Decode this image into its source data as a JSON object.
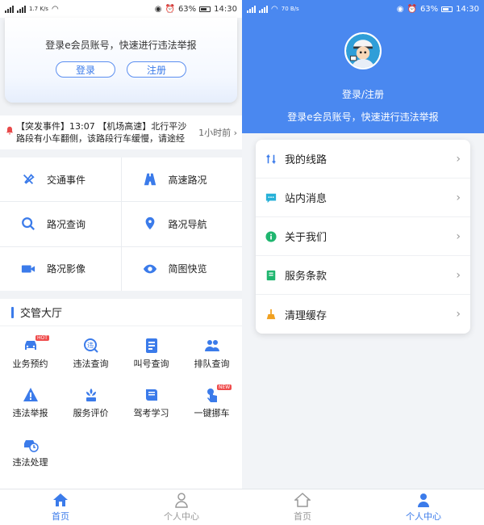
{
  "status_left": {
    "carrier": "⁴⁶ .ıll ⁴⁶ .ıll",
    "speed_left": "1.7 K/s",
    "speed_right": "70 B/s"
  },
  "status_right": {
    "battery": "63%",
    "time": "14:30"
  },
  "home": {
    "login_prompt": "登录e会员账号，快速进行违法举报",
    "login_button": "登录",
    "register_button": "注册",
    "news_text": "【突发事件】13:07 【机场高速】北行平沙路段有小车翻侧，该路段行车缓慢，请途经",
    "news_time": "1小时前",
    "services": [
      {
        "label": "交通事件",
        "icon": "alert-icon"
      },
      {
        "label": "高速路况",
        "icon": "road-icon"
      },
      {
        "label": "路况查询",
        "icon": "search-icon"
      },
      {
        "label": "路况导航",
        "icon": "location-icon"
      },
      {
        "label": "路况影像",
        "icon": "video-icon"
      },
      {
        "label": "简图快览",
        "icon": "eye-icon"
      }
    ],
    "hall_title": "交管大厅",
    "hall_items": [
      {
        "label": "业务预约",
        "icon": "car-icon",
        "badge": "HOT"
      },
      {
        "label": "违法查询",
        "icon": "query-icon"
      },
      {
        "label": "叫号查询",
        "icon": "number-icon"
      },
      {
        "label": "排队查询",
        "icon": "queue-icon"
      },
      {
        "label": "违法举报",
        "icon": "warning-icon"
      },
      {
        "label": "服务评价",
        "icon": "flower-icon"
      },
      {
        "label": "驾考学习",
        "icon": "book-icon"
      },
      {
        "label": "一键挪车",
        "icon": "hand-icon",
        "badge": "NEW"
      },
      {
        "label": "违法处理",
        "icon": "car-process-icon"
      }
    ]
  },
  "tabs": [
    {
      "label": "首页",
      "icon": "home-icon"
    },
    {
      "label": "个人中心",
      "icon": "person-icon"
    }
  ],
  "profile": {
    "login_link": "登录/注册",
    "login_hint": "登录e会员账号，快速进行违法举报",
    "menu": [
      {
        "label": "我的线路",
        "icon": "route-icon"
      },
      {
        "label": "站内消息",
        "icon": "message-icon"
      },
      {
        "label": "关于我们",
        "icon": "info-icon"
      },
      {
        "label": "服务条款",
        "icon": "terms-icon"
      },
      {
        "label": "清理缓存",
        "icon": "broom-icon"
      }
    ]
  },
  "colors": {
    "accent": "#3b7bea",
    "header_blue": "#4a88f0",
    "alert_red": "#e84a4a"
  }
}
